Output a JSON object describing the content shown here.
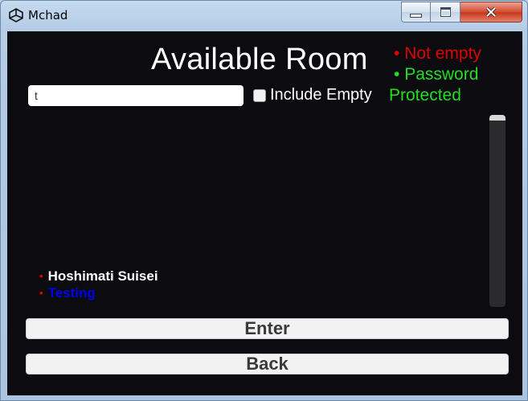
{
  "window": {
    "title": "Mchad"
  },
  "header": {
    "title": "Available Room"
  },
  "legend": {
    "not_empty": "Not empty",
    "not_empty_color": "#e00000",
    "password": "Password",
    "protected": "Protected",
    "password_color": "#22dd22",
    "bullet": "•"
  },
  "search": {
    "value": "t",
    "placeholder": ""
  },
  "filter": {
    "include_empty_label": "Include Empty",
    "include_empty_checked": false
  },
  "rooms": [
    {
      "name": "Hoshimati Suisei",
      "name_color": "#ffffff",
      "bullet_color": "#e00000"
    },
    {
      "name": "Testing",
      "name_color": "#0000ee",
      "bullet_color": "#e00000"
    }
  ],
  "actions": {
    "enter_label": "Enter",
    "back_label": "Back"
  },
  "icons": {
    "app": "unity-logo-icon",
    "minimize": "minimize-icon",
    "maximize": "maximize-icon",
    "close": "close-icon"
  }
}
